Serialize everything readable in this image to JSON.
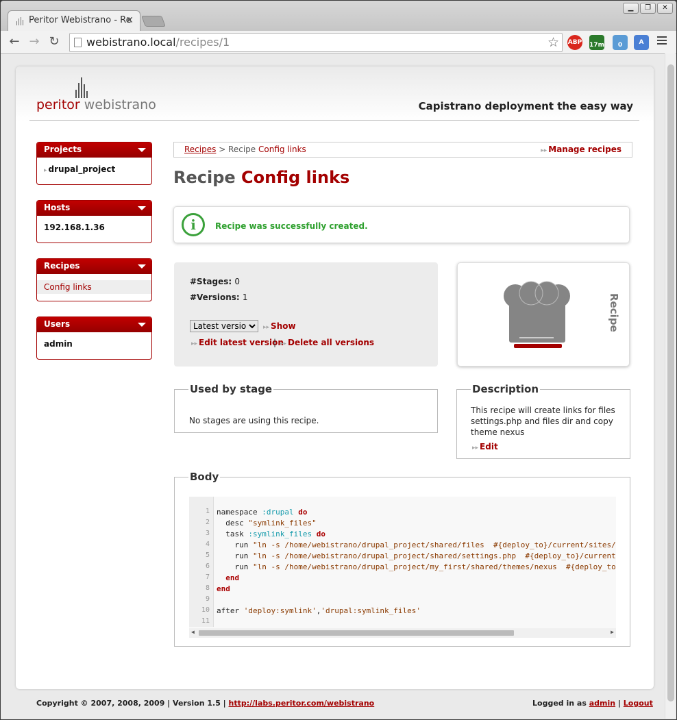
{
  "browser": {
    "tab_title": "Peritor Webistrano - Re",
    "tab_close": "✕",
    "url_host": "webistrano.local",
    "url_path": "/recipes/1",
    "window_controls": [
      "▁",
      "❐",
      "✕"
    ],
    "nav": {
      "back": "←",
      "forward": "→",
      "reload": "↻"
    },
    "star": "☆",
    "extensions": [
      {
        "name": "adblock-icon",
        "label": "ABP",
        "color": "#d9261c"
      },
      {
        "name": "weather-icon",
        "label": "17m",
        "color": "#2b7a2b"
      },
      {
        "name": "ghost-icon",
        "label": "0",
        "color": "#5a9bd5"
      },
      {
        "name": "translate-icon",
        "label": "A",
        "color": "#4a7fd4"
      }
    ]
  },
  "header": {
    "logo_a": "peritor",
    "logo_b": " webistrano",
    "tagline": "Capistrano deployment the easy way"
  },
  "sidebar": {
    "projects": {
      "title": "Projects",
      "items": [
        "drupal_project"
      ]
    },
    "hosts": {
      "title": "Hosts",
      "items": [
        "192.168.1.36"
      ]
    },
    "recipes": {
      "title": "Recipes",
      "items": [
        "Config links"
      ]
    },
    "users": {
      "title": "Users",
      "items": [
        "admin"
      ]
    }
  },
  "breadcrumb": {
    "root": "Recipes",
    "sep": " > Recipe ",
    "current": "Config links",
    "manage": "Manage recipes"
  },
  "page_title": {
    "prefix": "Recipe ",
    "name": "Config links"
  },
  "flash": {
    "icon": "i",
    "message": "Recipe was successfully created."
  },
  "stats": {
    "stages_label": "#Stages:",
    "stages_value": "0",
    "versions_label": "#Versions:",
    "versions_value": "1",
    "version_select": "Latest version",
    "show": "Show",
    "edit_latest": "Edit latest version",
    "sep": "|",
    "delete_all": "Delete all versions"
  },
  "recipe_card": {
    "label": "Recipe"
  },
  "used_by_stage": {
    "title": "Used by stage",
    "text": "No stages are using this recipe."
  },
  "description": {
    "title": "Description",
    "text": "This recipe will create links for files settings.php and files dir and copy theme nexus",
    "edit": "Edit"
  },
  "body": {
    "title": "Body",
    "lines": [
      {
        "n": "1",
        "t": ""
      },
      {
        "n": "2",
        "t": ""
      },
      {
        "n": "3",
        "t": ""
      },
      {
        "n": "4",
        "t": ""
      },
      {
        "n": "5",
        "t": ""
      },
      {
        "n": "6",
        "t": ""
      },
      {
        "n": "7",
        "t": ""
      },
      {
        "n": "8",
        "t": ""
      },
      {
        "n": "9",
        "t": ""
      },
      {
        "n": "10",
        "t": ""
      },
      {
        "n": "11",
        "t": ""
      }
    ],
    "code": [
      "namespace :drupal do",
      "  desc \"symlink_files\"",
      "  task :symlink_files do",
      "    run \"ln -s /home/webistrano/drupal_project/shared/files  #{deploy_to}/current/sites/d",
      "    run \"ln -s /home/webistrano/drupal_project/shared/settings.php  #{deploy_to}/current/",
      "    run \"ln -s /home/webistrano/drupal_project/my_first/shared/themes/nexus  #{deploy_to",
      "  end",
      "end",
      "",
      "after 'deploy:symlink','drupal:symlink_files'",
      ""
    ]
  },
  "footer": {
    "copyright": "Copyright © 2007, 2008, 2009 | Version 1.5 | ",
    "link": "http://labs.peritor.com/webistrano",
    "logged_in": "Logged in as ",
    "user": "admin",
    "sep": " | ",
    "logout": "Logout"
  }
}
